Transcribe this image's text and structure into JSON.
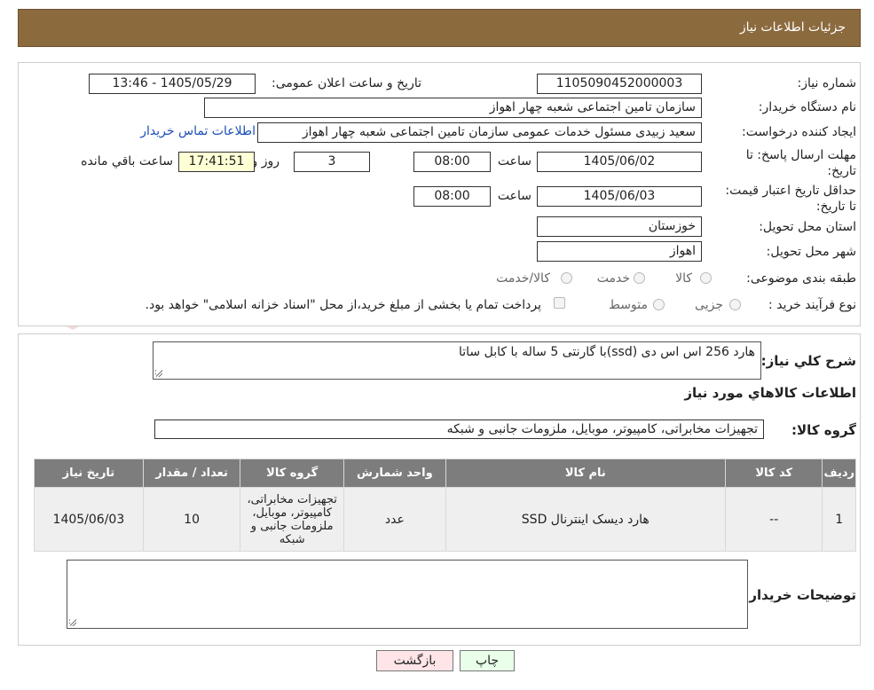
{
  "header": {
    "title": "جزئیات اطلاعات نیاز"
  },
  "form": {
    "need_number_label": "شماره نیاز:",
    "need_number": "1105090452000003",
    "announce_label": "تاریخ و ساعت اعلان عمومی:",
    "announce_value": "1405/05/29 - 13:46",
    "buyer_org_label": "نام دستگاه خریدار:",
    "buyer_org": "سازمان تامین اجتماعی شعبه چهار اهواز",
    "requester_label": "ایجاد کننده درخواست:",
    "requester": "سعید زبیدی مسئول خدمات عمومی سازمان تامین اجتماعی شعبه چهار اهواز",
    "contact_link": "اطلاعات تماس خریدار",
    "reply_deadline_label": "مهلت ارسال پاسخ: تا تاریخ:",
    "reply_date": "1405/06/02",
    "time_label": "ساعت",
    "reply_time": "08:00",
    "days_value": "3",
    "days_label": "روز و",
    "remaining_time": "17:41:51",
    "remaining_label": "ساعت باقي مانده",
    "validity_label": "حداقل تاریخ اعتبار قیمت: تا تاریخ:",
    "validity_date": "1405/06/03",
    "validity_time": "08:00",
    "province_label": "استان محل تحویل:",
    "province": "خوزستان",
    "city_label": "شهر محل تحویل:",
    "city": "اهواز",
    "category_label": "طبقه بندی موضوعی:",
    "category_options": [
      "کالا",
      "خدمت",
      "کالا/خدمت"
    ],
    "process_label": "نوع فرآیند خرید :",
    "process_options": [
      "جزیی",
      "متوسط"
    ],
    "payment_note": "پرداخت تمام یا بخشی از مبلغ خرید،از محل \"اسناد خزانه اسلامی\" خواهد بود."
  },
  "description": {
    "label": "شرح کلي نياز:",
    "value": "هارد 256 اس اس دی  (ssd)با گارنتی 5 ساله با کابل ساتا"
  },
  "goods_info_title": "اطلاعات کالاهاي مورد نياز",
  "goods_group": {
    "label": "گروه کالا:",
    "value": "تجهیزات مخابراتی، کامپیوتر، موبایل، ملزومات جانبی و شبکه"
  },
  "table": {
    "headers": [
      "رديف",
      "کد کالا",
      "نام کالا",
      "واحد شمارش",
      "گروه کالا",
      "تعداد / مقدار",
      "تاریخ نیاز"
    ],
    "rows": [
      [
        "1",
        "--",
        "هارد دیسک اینترنال SSD",
        "عدد",
        "تجهیزات مخابراتی، کامپیوتر، موبایل، ملزومات جانبی و شبکه",
        "10",
        "1405/06/03"
      ]
    ]
  },
  "buyer_notes": {
    "label": "توضیحات خریدار:",
    "value": ""
  },
  "buttons": {
    "print": "چاپ",
    "back": "بازگشت"
  },
  "watermark": "AriaTender.neT",
  "colors": {
    "header": "#8b6a3e",
    "table_header": "#7d7d7d",
    "remaining_bg": "#ffffd6",
    "back_button": "#ffe5e8",
    "print_button": "#eaffea",
    "link": "#1a4fb5"
  }
}
